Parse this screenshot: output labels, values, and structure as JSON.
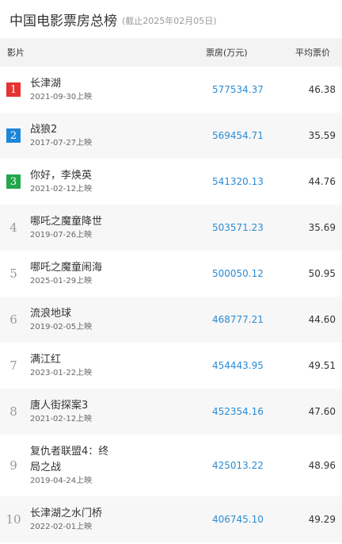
{
  "header": {
    "title": "中国电影票房总榜",
    "subtitle": "(截止2025年02月05日)"
  },
  "table": {
    "columns": [
      "影片",
      "票房(万元)",
      "平均票价"
    ],
    "rows": [
      {
        "rank": "1",
        "name": "长津湖",
        "date": "2021-09-30上映",
        "box": "577534.37",
        "avg": "46.38",
        "badge_color": "#e63232"
      },
      {
        "rank": "2",
        "name": "战狼2",
        "date": "2017-07-27上映",
        "box": "569454.71",
        "avg": "35.59",
        "badge_color": "#1c86d8"
      },
      {
        "rank": "3",
        "name": "你好，李焕英",
        "date": "2021-02-12上映",
        "box": "541320.13",
        "avg": "44.76",
        "badge_color": "#22a74a"
      },
      {
        "rank": "4",
        "name": "哪吒之魔童降世",
        "date": "2019-07-26上映",
        "box": "503571.23",
        "avg": "35.69"
      },
      {
        "rank": "5",
        "name": "哪吒之魔童闹海",
        "date": "2025-01-29上映",
        "box": "500050.12",
        "avg": "50.95"
      },
      {
        "rank": "6",
        "name": "流浪地球",
        "date": "2019-02-05上映",
        "box": "468777.21",
        "avg": "44.60"
      },
      {
        "rank": "7",
        "name": "满江红",
        "date": "2023-01-22上映",
        "box": "454443.95",
        "avg": "49.51"
      },
      {
        "rank": "8",
        "name": "唐人街探案3",
        "date": "2021-02-12上映",
        "box": "452354.16",
        "avg": "47.60"
      },
      {
        "rank": "9",
        "name": "复仇者联盟4：终局之战",
        "date": "2019-04-24上映",
        "box": "425013.22",
        "avg": "48.96"
      },
      {
        "rank": "10",
        "name": "长津湖之水门桥",
        "date": "2022-02-01上映",
        "box": "406745.10",
        "avg": "49.29"
      }
    ]
  }
}
